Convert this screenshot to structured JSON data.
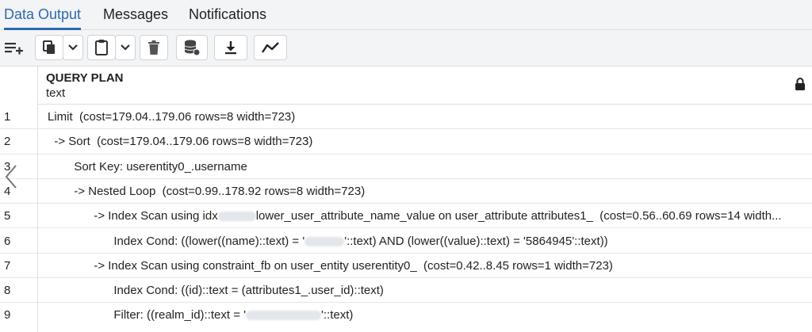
{
  "tabs": [
    {
      "label": "Data Output",
      "active": true
    },
    {
      "label": "Messages",
      "active": false
    },
    {
      "label": "Notifications",
      "active": false
    }
  ],
  "toolbar": {
    "buttons": [
      "add-row-icon",
      "copy-icon",
      "chevron-down-icon",
      "paste-icon",
      "chevron-down-icon",
      "delete-icon",
      "save-data-icon",
      "download-icon",
      "graph-visualiser-icon"
    ]
  },
  "grid": {
    "column": {
      "name": "QUERY PLAN",
      "type": "text"
    },
    "rows": [
      {
        "num": "1",
        "segments": [
          "Limit  (cost=179.04..179.06 rows=8 width=723)"
        ]
      },
      {
        "num": "2",
        "segments": [
          "  -> Sort  (cost=179.04..179.06 rows=8 width=723)"
        ]
      },
      {
        "num": "3",
        "segments": [
          "        Sort Key: userentity0_.username"
        ]
      },
      {
        "num": "4",
        "segments": [
          "        -> Nested Loop  (cost=0.99..178.92 rows=8 width=723)"
        ]
      },
      {
        "num": "5",
        "segments": [
          "              -> Index Scan using idx",
          "lower_user_attribute_name_value on user_attribute attributes1_  (cost=0.56..60.69 rows=14 width..."
        ]
      },
      {
        "num": "6",
        "segments": [
          "                    Index Cond: ((lower((name)::text) = '",
          "'::text) AND (lower((value)::text) = '5864945'::text))"
        ]
      },
      {
        "num": "7",
        "segments": [
          "              -> Index Scan using constraint_fb on user_entity userentity0_  (cost=0.42..8.45 rows=1 width=723)"
        ]
      },
      {
        "num": "8",
        "segments": [
          "                    Index Cond: ((id)::text = (attributes1_.user_id)::text)"
        ]
      },
      {
        "num": "9",
        "segments": [
          "                    Filter: ((realm_id)::text = '",
          "'::text)"
        ]
      }
    ]
  }
}
